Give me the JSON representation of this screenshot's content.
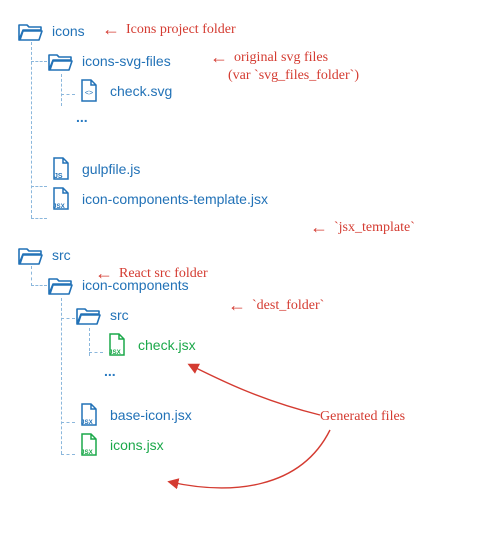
{
  "colors": {
    "blue": "#2272b7",
    "green": "#1ba84a",
    "red": "#d43b31",
    "guide": "#8bb7dc"
  },
  "tree1": {
    "root": {
      "name": "icons",
      "type": "folder-open"
    },
    "child1": {
      "name": "icons-svg-files",
      "type": "folder-open",
      "files": [
        {
          "name": "check.svg",
          "type": "file-svg"
        }
      ],
      "ellipsis": "..."
    },
    "files": [
      {
        "name": "gulpfile.js",
        "type": "file-js"
      },
      {
        "name": "icon-components-template.jsx",
        "type": "file-jsx"
      }
    ]
  },
  "tree2": {
    "root": {
      "name": "src",
      "type": "folder-open"
    },
    "child1": {
      "name": "icon-components",
      "type": "folder-open",
      "child": {
        "name": "src",
        "type": "folder-open",
        "files": [
          {
            "name": "check.jsx",
            "type": "file-jsx-green"
          }
        ],
        "ellipsis": "..."
      },
      "files": [
        {
          "name": "base-icon.jsx",
          "type": "file-jsx"
        },
        {
          "name": "icons.jsx",
          "type": "file-jsx-green"
        }
      ]
    }
  },
  "annotations": {
    "icons_project": "Icons project folder",
    "original_svg_l1": "original svg files",
    "original_svg_l2": "(var `svg_files_folder`)",
    "jsx_template": "`jsx_template`",
    "react_src": "React src folder",
    "dest_folder": "`dest_folder`",
    "generated": "Generated files"
  }
}
